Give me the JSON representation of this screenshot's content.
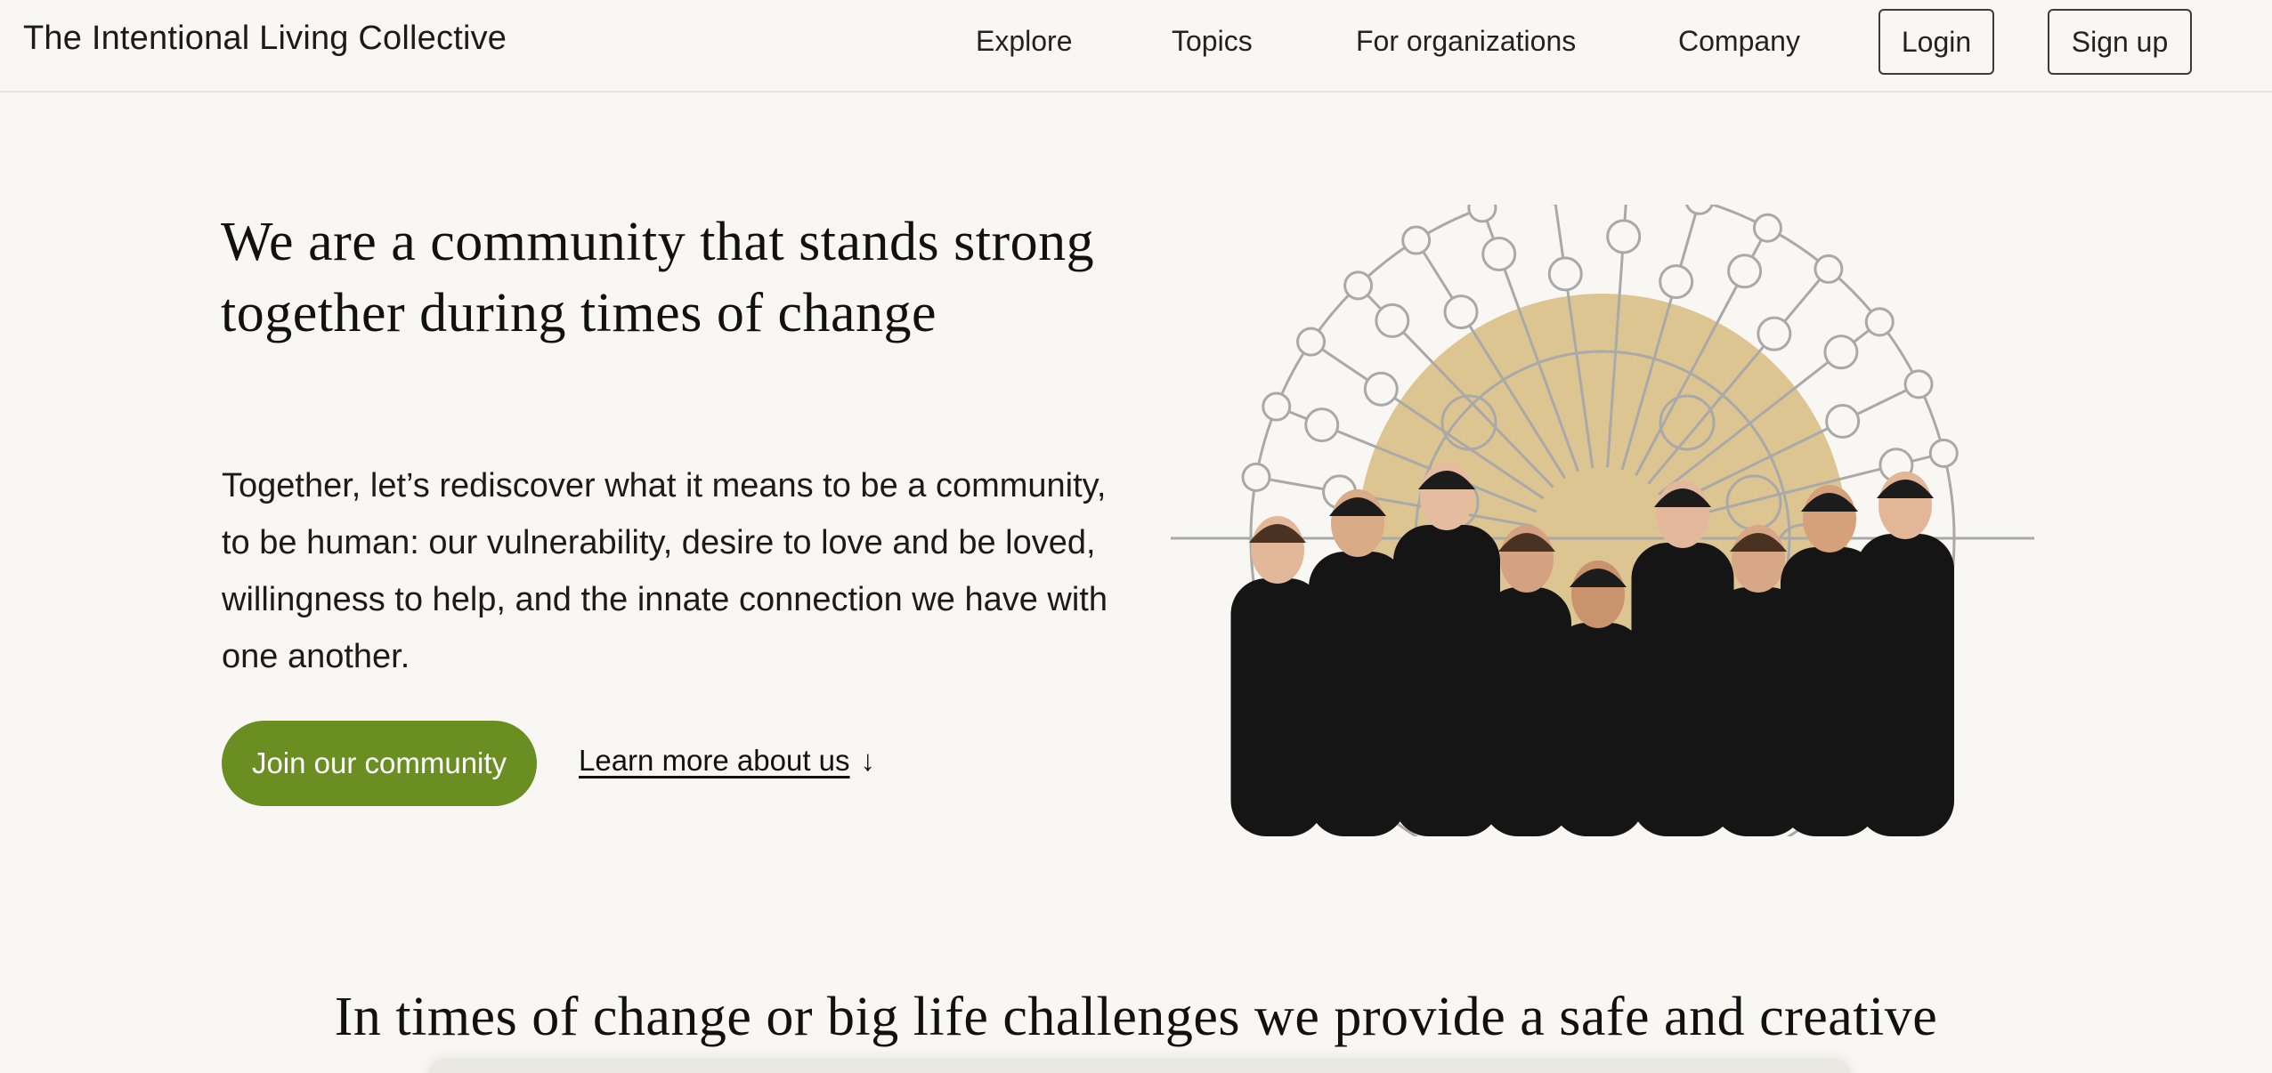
{
  "nav": {
    "brand": "The Intentional Living Collective",
    "links": [
      "Explore",
      "Topics",
      "For organizations",
      "Company"
    ],
    "login_label": "Login",
    "signup_label": "Sign up"
  },
  "hero": {
    "title": "We are a community that stands strong together during times of change",
    "body": "Together, let’s rediscover what it means to be a community, to be human: our vulnerability, desire to love and be loved, willingness to help, and the innate connection we have with one another.",
    "cta_label": "Join our community",
    "learn_more_label": "Learn more about us",
    "learn_more_arrow": "↓"
  },
  "section2": {
    "title": "In times of change or big life challenges we provide a safe and creative"
  },
  "colors": {
    "background": "#f8f7f3",
    "accent_green": "#6b8e23",
    "sun_gold": "#dcc591",
    "network_gray": "#a9a9a9"
  }
}
